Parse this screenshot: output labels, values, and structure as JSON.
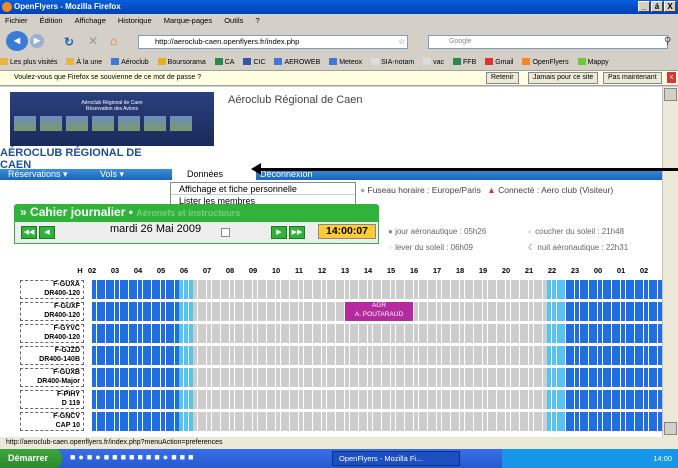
{
  "window": {
    "title": "OpenFlyers - Mozilla Firefox",
    "min": "_",
    "max": "á",
    "close": "X"
  },
  "menu": [
    "Fichier",
    "Édition",
    "Affichage",
    "Historique",
    "Marque-pages",
    "Outils",
    "?"
  ],
  "address": {
    "url": "http://aeroclub-caen.openflyers.fr/index.php",
    "search_placeholder": "Google"
  },
  "bookmarks": [
    "Les plus visités",
    "À la une",
    "Aéroclub",
    "Boursorama",
    "CA",
    "CIC",
    "AEROWEB",
    "Meteox",
    "SIA-notam",
    "vac",
    "FFB",
    "Gmail",
    "OpenFlyers",
    "Mappy"
  ],
  "password_bar": {
    "message": "Voulez-vous que Firefox se souvienne de ce mot de passe ?",
    "remember": "Retenir",
    "never": "Jamais pour ce site",
    "not_now": "Pas maintenant"
  },
  "banner": {
    "line1": "Aéroclub Régional de Caen",
    "line2": "Réservation des Avions"
  },
  "site_title": "Aéroclub Régional de Caen",
  "club_name_line1": "AÉROCLUB RÉGIONAL DE",
  "club_name_line2": "CAEN",
  "nav": {
    "reservations": "Réservations",
    "vols": "Vols",
    "donnees": "Données",
    "deconnexion": "Déconnexion"
  },
  "dropdown": [
    "Affichage et fiche personnelle",
    "Lister les membres"
  ],
  "info": {
    "timezone": "Fuseau horaire : Europe/Paris",
    "connected": "Connecté : Aero club (Visiteur)"
  },
  "cahier": {
    "title": "Cahier journalier",
    "subtitle": "Aéronefs et instructeurs"
  },
  "date": "mardi 26 Mai 2009",
  "time": "14:00:07",
  "sun": {
    "jour": "jour aéronautique : 05h26",
    "lever": "lever du soleil : 06h09",
    "coucher": "coucher du soleil : 21h48",
    "nuit": "nuit aéronautique : 22h31"
  },
  "hours": [
    "H",
    "02",
    "03",
    "04",
    "05",
    "06",
    "07",
    "08",
    "09",
    "10",
    "11",
    "12",
    "13",
    "14",
    "15",
    "16",
    "17",
    "18",
    "19",
    "20",
    "21",
    "22",
    "23",
    "00",
    "01",
    "02"
  ],
  "aircraft": [
    {
      "reg": "F-GUXA",
      "type": "DR400-120"
    },
    {
      "reg": "F-GUXF",
      "type": "DR400-120"
    },
    {
      "reg": "F-GYVC",
      "type": "DR400-120"
    },
    {
      "reg": "F-GJZD",
      "type": "DR400-140B"
    },
    {
      "reg": "F-GUXB",
      "type": "DR400-Major"
    },
    {
      "reg": "F-PIHY",
      "type": "D 119"
    },
    {
      "reg": "F-GNCV",
      "type": "CAP 10"
    }
  ],
  "booking": {
    "code": "AGR",
    "pilot": "A. POUTARAUD"
  },
  "status_url": "http://aeroclub-caen.openflyers.fr/index.php?menuAction=preferences",
  "taskbar": {
    "start": "Démarrer",
    "task": "OpenFlyers - Mozilla Fi...",
    "clock": "14:00"
  },
  "colors": {
    "night": "#1f6fe0",
    "twilight": "#55c4ef",
    "day": "#cdcdcd",
    "booking": "#b52a9e",
    "accent_green": "#2fb33a"
  }
}
